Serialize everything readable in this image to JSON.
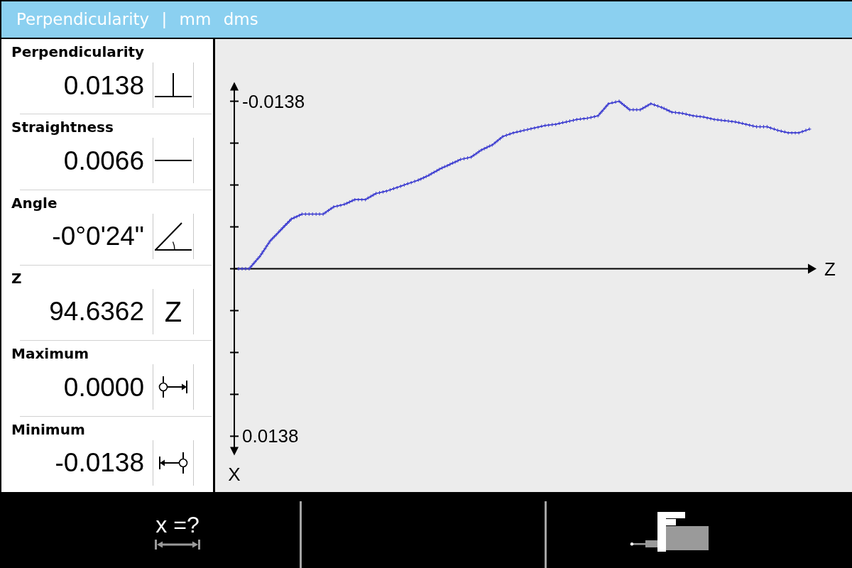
{
  "title_bar": {
    "title": "Perpendicularity | mm dms"
  },
  "readouts": [
    {
      "kind": "perpendicularity",
      "name": "Perpendicularity",
      "reading": "0.0138"
    },
    {
      "kind": "straightness",
      "name": "Straightness",
      "reading": "0.0066"
    },
    {
      "kind": "angle",
      "name": "Angle",
      "reading": "-0°0'24\""
    },
    {
      "kind": "axis",
      "name": "Z",
      "reading": "94.6362",
      "symbol": "Z"
    },
    {
      "kind": "maximum",
      "name": "Maximum",
      "reading": "0.0000"
    },
    {
      "kind": "minimum",
      "name": "Minimum",
      "reading": "-0.0138"
    }
  ],
  "plot": {
    "chart_data": {
      "type": "line",
      "xlabel": "Z",
      "ylabel": "X",
      "ylim": [
        0.0148,
        -0.0148
      ],
      "yticks": [
        -0.0138,
        0.0138
      ],
      "categories": [
        null,
        null,
        null,
        null,
        null,
        null,
        null,
        null,
        null,
        null,
        null,
        null,
        null,
        null,
        null,
        null,
        null,
        null,
        null,
        null,
        null,
        null,
        null,
        null,
        null,
        null,
        null,
        null,
        null,
        null,
        null,
        null,
        null,
        null,
        null,
        null,
        null,
        null,
        null,
        null,
        null,
        null,
        null,
        null,
        null,
        null,
        null,
        null,
        null,
        null,
        null,
        null,
        null,
        null,
        null
      ],
      "series": [
        {
          "color": "#3a3ad0",
          "values": [
            0,
            0,
            -0.001,
            -0.0023,
            -0.0032,
            -0.0041,
            -0.0045,
            -0.0045,
            -0.0045,
            -0.0051,
            -0.0053,
            -0.0057,
            -0.0057,
            -0.0062,
            -0.0064,
            -0.0067,
            -0.007,
            -0.0073,
            -0.0077,
            -0.0082,
            -0.0086,
            -0.009,
            -0.0092,
            -0.0098,
            -0.0102,
            -0.0109,
            -0.0112,
            -0.0114,
            -0.0116,
            -0.0118,
            -0.0119,
            -0.0121,
            -0.0123,
            -0.0124,
            -0.0126,
            -0.0136,
            -0.0138,
            -0.0131,
            -0.0131,
            -0.0136,
            -0.0133,
            -0.0129,
            -0.0128,
            -0.0126,
            -0.0125,
            -0.0123,
            -0.0122,
            -0.0121,
            -0.0119,
            -0.0117,
            -0.0117,
            -0.0114,
            -0.0112,
            -0.0112,
            -0.0115
          ]
        }
      ]
    }
  },
  "softkeys": [
    {
      "kind": "dimension",
      "label": "x =?"
    },
    {
      "kind": "blank"
    },
    {
      "kind": "probe"
    }
  ]
}
